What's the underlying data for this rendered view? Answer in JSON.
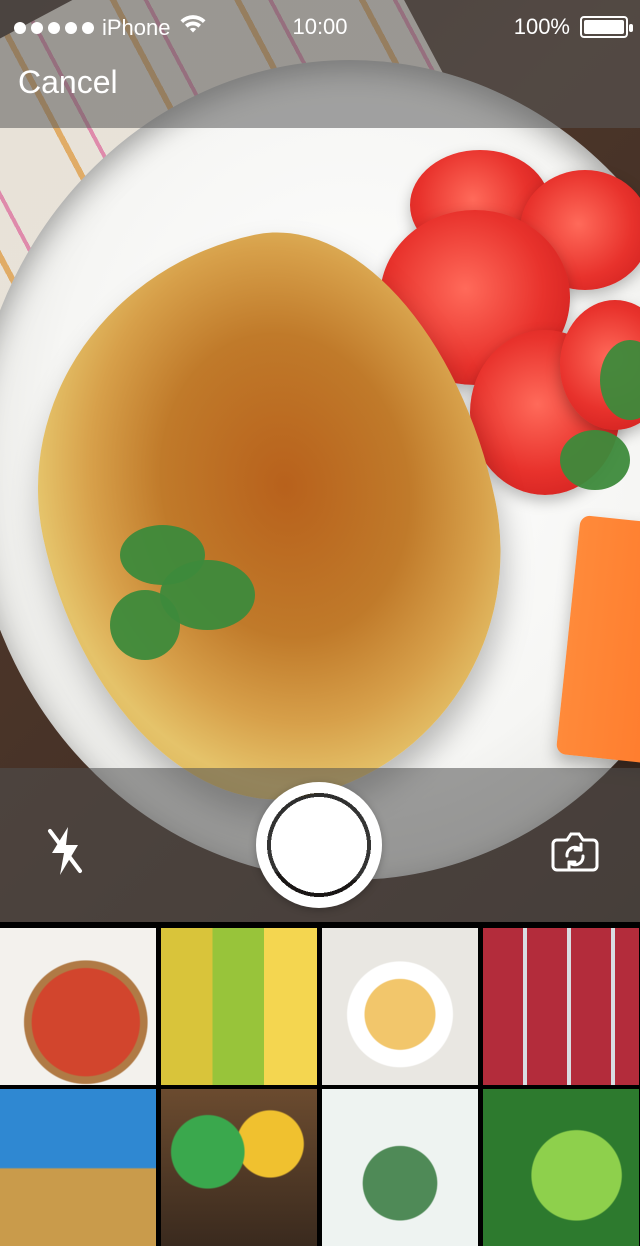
{
  "status_bar": {
    "carrier": "iPhone",
    "time": "10:00",
    "battery_percent_label": "100%",
    "signal_icon": "signal-dots-icon",
    "wifi_icon": "wifi-icon",
    "battery_icon": "battery-full-icon"
  },
  "topbar": {
    "cancel_label": "Cancel"
  },
  "controls": {
    "flash_icon": "flash-off-icon",
    "shutter_icon": "shutter-button",
    "switch_camera_icon": "switch-camera-icon"
  },
  "gallery": {
    "thumbnails": [
      {
        "name": "thumb-tart"
      },
      {
        "name": "thumb-peppers"
      },
      {
        "name": "thumb-fries"
      },
      {
        "name": "thumb-meat"
      },
      {
        "name": "thumb-pasta-bowl"
      },
      {
        "name": "thumb-produce"
      },
      {
        "name": "thumb-plant"
      },
      {
        "name": "thumb-greens"
      }
    ]
  },
  "colors": {
    "overlay": "#5a5a5a",
    "text": "#ffffff"
  }
}
